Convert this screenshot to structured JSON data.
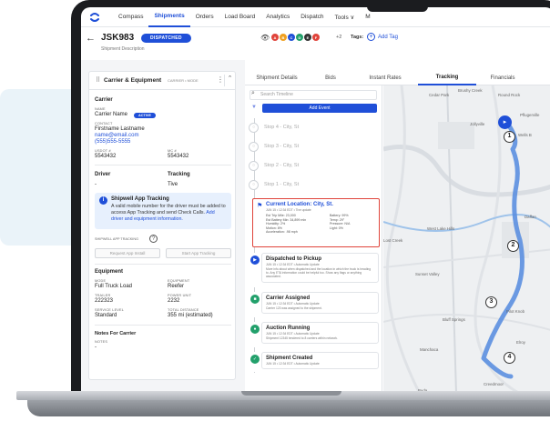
{
  "nav": {
    "items": [
      "Compass",
      "Shipments",
      "Orders",
      "Load Board",
      "Analytics",
      "Dispatch",
      "Tools ∨",
      "M"
    ],
    "active": "Shipments"
  },
  "header": {
    "load_id": "JSK983",
    "status": "DISPATCHED",
    "description": "Shipment Description",
    "avatar_extra": "+2",
    "tags_label": "Tags:",
    "add_tag": "Add Tag",
    "avatar_colors": [
      "#e0443b",
      "#f0a020",
      "#1f4fd8",
      "#22a06b",
      "#333333",
      "#e0443b"
    ]
  },
  "carrier_card": {
    "title": "Carrier & Equipment",
    "subtitle": "CARRIER • MODE",
    "carrier_section": "Carrier",
    "name_label": "NAME",
    "name_value": "Carrier Name",
    "active_badge": "ACTIVE",
    "contact_label": "CONTACT",
    "contact_name": "Firstname Lastname",
    "contact_email": "name@email.com",
    "contact_phone": "(555)555-5555",
    "usdot_label": "USDOT #",
    "usdot_value": "5543432",
    "mc_label": "MC #",
    "mc_value": "5543432",
    "driver_label": "Driver",
    "driver_value": "-",
    "tracking_label": "Tracking",
    "tracking_value": "Tive",
    "info_title": "Shipwell App Tracking",
    "info_body": "A valid mobile number for the driver must be added to access App Tracking and send Check Calls.",
    "info_link": "Add driver and equipment information.",
    "app_tracking_label": "SHIPWELL APP TRACKING",
    "request_install": "Request App Install",
    "start_tracking": "Start App Tracking",
    "equipment_section": "Equipment",
    "mode_label": "MODE",
    "mode_value": "Full Truck Load",
    "equipment_label": "EQUIPMENT",
    "equipment_value": "Reefer",
    "trailer_label": "TRAILER",
    "trailer_value": "222323",
    "power_label": "POWER UNIT",
    "power_value": "2232",
    "service_label": "SERVICE LEVEL",
    "service_value": "Standard",
    "distance_label": "TOTAL DISTANCE",
    "distance_value": "355 mi (estimated)",
    "notes_section": "Notes For Carrier",
    "notes_label": "NOTES",
    "notes_value": "-"
  },
  "tabs": [
    "Shipment Details",
    "Bids",
    "Instant Rates",
    "Tracking",
    "Financials"
  ],
  "active_tab": "Tracking",
  "timeline": {
    "search_placeholder": "Search Timeline",
    "add_event": "Add Event",
    "stops": [
      "Stop 4 - City, St",
      "Stop 3 - City, St",
      "Stop 2 - City, St",
      "Stop 1 - City, St"
    ],
    "current": {
      "title": "Current Location: City, St.",
      "meta": "JUN 15 • 12:34 EDT • Tive update",
      "stats": [
        "Est Trip Mile: 23,000",
        "Battery: 99%",
        "Est Battery Min: 34,899 min",
        "Temp: 29°",
        "Humidity: 2%",
        "Pressure: N/A",
        "Motion: 8%",
        "Light: 0%",
        "Acceleration: .98 mph",
        ""
      ]
    },
    "events": [
      {
        "title": "Dispatched to Pickup",
        "meta": "JUN 15 • 12:34 EDT • Automatic Update",
        "desc": "More info about when dispatched and the location in which the truck is heading to. Any ETA information could be helpful too. Show any flags or anything associated."
      },
      {
        "title": "Carrier Assigned",
        "meta": "JUN 15 • 12:34 EDT • Automatic Update",
        "desc": "Carrier 123 was assigned to the shipment."
      },
      {
        "title": "Auction Running",
        "meta": "JUN 15 • 12:34 EDT • Automatic Update",
        "desc": "Shipment 12345 tendered to 8 carriers within network."
      },
      {
        "title": "Shipment Created",
        "meta": "JUN 15 • 12:34 EDT • Automatic Update",
        "desc": ""
      }
    ],
    "event_colors": [
      "#1f4fd8",
      "#22a06b",
      "#22a06b",
      "#22a06b"
    ]
  },
  "map": {
    "labels": [
      "Brushy Creek",
      "Round Rock",
      "Cedar Park",
      "Jollyville",
      "Pflugerville",
      "Wells B",
      "Daffan",
      "West Lake Hills",
      "Lost Creek",
      "Sunset Valley",
      "Bluff Springs",
      "Pilot Knob",
      "Manchaca",
      "Elroy",
      "Creedmoor",
      "Buda"
    ],
    "markers": [
      "1",
      "2",
      "3",
      "4"
    ],
    "route_color": "#5b8fe0"
  }
}
